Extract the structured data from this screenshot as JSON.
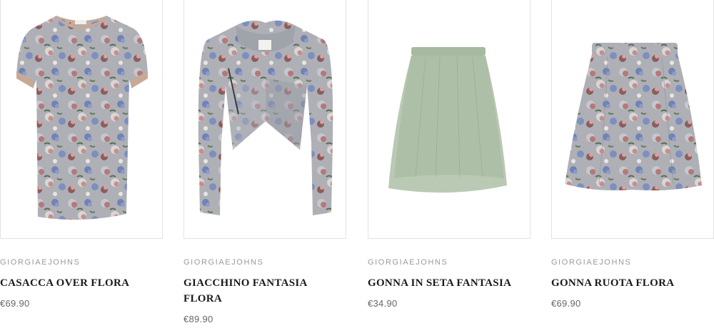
{
  "products": [
    {
      "brand": "GIORGIAEJOHNS",
      "name": "CASACCA OVER FLORA",
      "price": "€69.90",
      "image": "floral-tunic"
    },
    {
      "brand": "GIORGIAEJOHNS",
      "name": "GIACCHINO FANTASIA FLORA",
      "price": "€89.90",
      "image": "floral-cropped-jacket"
    },
    {
      "brand": "GIORGIAEJOHNS",
      "name": "GONNA IN SETA FANTASIA",
      "price": "€34.90",
      "image": "sage-silk-skirt"
    },
    {
      "brand": "GIORGIAEJOHNS",
      "name": "GONNA RUOTA FLORA",
      "price": "€69.90",
      "image": "floral-circle-skirt"
    }
  ],
  "colors": {
    "floral_base": "#a9acb3",
    "floral_rose": "#b5787a",
    "floral_blue": "#6f83b6",
    "sage": "#b9c9b3",
    "trim": "#c7a996"
  }
}
